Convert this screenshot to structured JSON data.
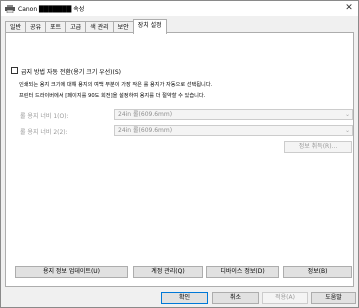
{
  "window": {
    "title": "Canon ███████ 속성"
  },
  "tabs": [
    "일반",
    "공유",
    "포트",
    "고급",
    "색 관리",
    "보안",
    "장치 설정"
  ],
  "settings": {
    "auto_switch_label": "급지 방법 자동 전환(용기 크기 우선)(S)",
    "desc_line1": "인쇄되는 용지 크기에 대해 용지의 여백 부분이 가장 작은 롤 용지가 자동으로 선택됩니다.",
    "desc_line2": "프린터 드라이버에서 [페이지를 90도 회전]을 설정하여 용지를 더 절약할 수 있습니다.",
    "roll1_label": "롤 용지 너비 1(O):",
    "roll1_value": "24in 롤(609.6mm)",
    "roll2_label": "롤 용지 너비 2(2):",
    "roll2_value": "24in 롤(609.6mm)",
    "info_button": "정보 취득(R)..."
  },
  "bottom_buttons": {
    "update_paper": "용지 정보 업데이트(U)",
    "account": "계정 관리(Q)",
    "device_info": "디바이스 정보(D)",
    "about": "정보(B)"
  },
  "dialog_buttons": {
    "ok": "확인",
    "cancel": "취소",
    "apply": "적용(A)",
    "help": "도움말"
  }
}
